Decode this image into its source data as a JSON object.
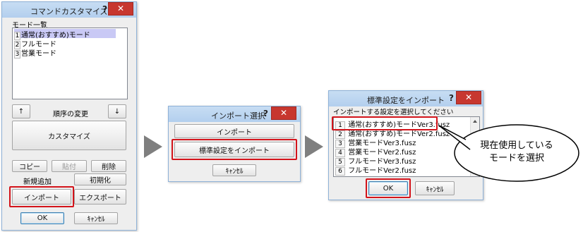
{
  "window1": {
    "title": "コマンドカスタマイズ",
    "help": "?",
    "close": "✕",
    "mode_list_label": "モード一覧",
    "modes": [
      {
        "num": "1",
        "label": "通常(おすすめ)モード"
      },
      {
        "num": "2",
        "label": "フルモード"
      },
      {
        "num": "3",
        "label": "営業モード"
      }
    ],
    "up_arrow": "↑",
    "order_change": "順序の変更",
    "down_arrow": "↓",
    "customize": "カスタマイズ",
    "copy": "コピー",
    "paste": "貼付",
    "delete": "削除",
    "new_add": "新規追加",
    "initialize": "初期化",
    "import": "インポート",
    "export": "エクスポート",
    "ok": "OK",
    "cancel": "ｷｬﾝｾﾙ"
  },
  "window2": {
    "title": "インポート選択",
    "help": "?",
    "close": "✕",
    "import": "インポート",
    "import_standard": "標準設定をインポート",
    "cancel": "ｷｬﾝｾﾙ"
  },
  "window3": {
    "title": "標準設定をインポート",
    "help": "?",
    "close": "✕",
    "prompt": "インポートする設定を選択してください",
    "files": [
      {
        "num": "1",
        "name": "通常(おすすめ)モードVer3.fusz"
      },
      {
        "num": "2",
        "name": "通常(おすすめ)モードVer2.fusz"
      },
      {
        "num": "3",
        "name": "営業モードVer3.fusz"
      },
      {
        "num": "4",
        "name": "営業モードVer2.fusz"
      },
      {
        "num": "5",
        "name": "フルモードVer3.fusz"
      },
      {
        "num": "6",
        "name": "フルモードVer2.fusz"
      }
    ],
    "ok": "OK",
    "cancel": "ｷｬﾝｾﾙ"
  },
  "callout": {
    "line1": "現在使用している",
    "line2": "モードを選択"
  },
  "colors": {
    "highlight_red": "#d3141b",
    "selection_blue": "#c9c9f5",
    "arrow_gray": "#7f7f7f"
  }
}
